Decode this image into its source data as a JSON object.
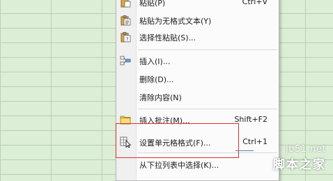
{
  "context_menu": {
    "items": [
      {
        "label": "粘贴(P)",
        "shortcut": "Ctrl+V",
        "icon": "paste-icon"
      },
      {
        "label": "粘贴为无格式文本(Y)",
        "shortcut": "",
        "icon": "paste-text-icon"
      },
      {
        "label": "选择性粘贴(S)...",
        "shortcut": "",
        "icon": "paste-special-icon"
      },
      {
        "label": "插入(I)...",
        "shortcut": "",
        "icon": "insert-cells-icon"
      },
      {
        "label": "删除(D)...",
        "shortcut": "",
        "icon": ""
      },
      {
        "label": "清除内容(N)",
        "shortcut": "",
        "icon": ""
      },
      {
        "label": "插入批注(M)...",
        "shortcut": "Shift+F2",
        "icon": "comment-icon"
      },
      {
        "label": "设置单元格格式(F)...",
        "shortcut": "Ctrl+1",
        "icon": "format-cells-icon"
      },
      {
        "label": "从下拉列表中选择(K)...",
        "shortcut": "",
        "icon": ""
      }
    ]
  },
  "watermark": {
    "domain": "jb51.net",
    "brand": "脚本之家"
  },
  "colors": {
    "grid_background": "#dcefd6",
    "highlight_border": "#d9322d"
  }
}
